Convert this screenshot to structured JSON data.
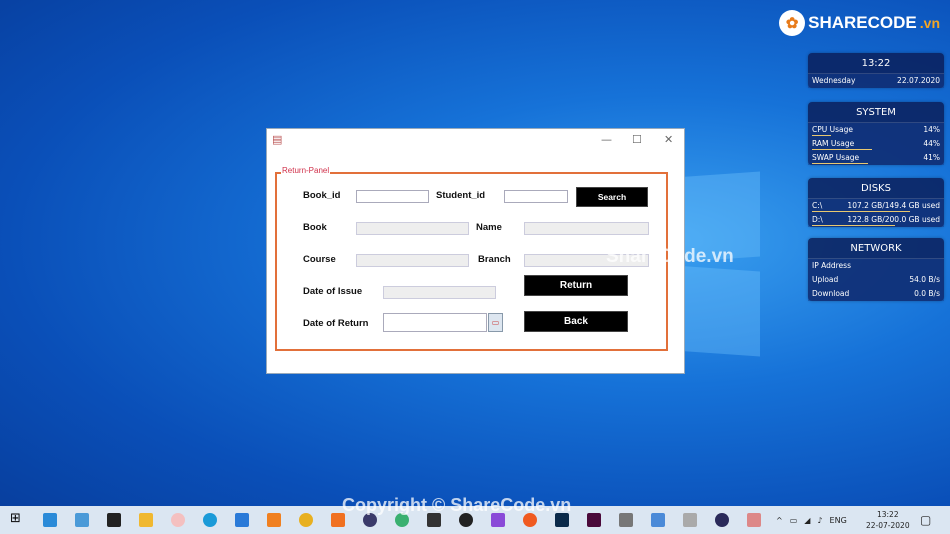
{
  "logo": {
    "text": "SHARECODE",
    "suffix": ".vn"
  },
  "widgets": {
    "clock": {
      "time": "13:22",
      "day": "Wednesday",
      "date": "22.07.2020"
    },
    "system": {
      "title": "SYSTEM",
      "rows": [
        {
          "label": "CPU Usage",
          "value": "14%",
          "pct": 14
        },
        {
          "label": "RAM Usage",
          "value": "44%",
          "pct": 44
        },
        {
          "label": "SWAP Usage",
          "value": "41%",
          "pct": 41
        }
      ]
    },
    "disks": {
      "title": "DISKS",
      "rows": [
        {
          "label": "C:\\",
          "value": "107.2 GB/149.4 GB used",
          "pct": 72
        },
        {
          "label": "D:\\",
          "value": "122.8 GB/200.0 GB used",
          "pct": 61
        }
      ]
    },
    "network": {
      "title": "NETWORK",
      "rows": [
        {
          "label": "IP Address",
          "value": ""
        },
        {
          "label": "Upload",
          "value": "54.0 B/s"
        },
        {
          "label": "Download",
          "value": "0.0 B/s"
        }
      ]
    }
  },
  "window": {
    "panel_title": "Return-Panel",
    "labels": {
      "book_id": "Book_id",
      "student_id": "Student_id",
      "book": "Book",
      "name": "Name",
      "course": "Course",
      "branch": "Branch",
      "date_issue": "Date of Issue",
      "date_return": "Date of Return"
    },
    "values": {
      "book_id": "",
      "student_id": "",
      "book": "",
      "name": "",
      "course": "",
      "branch": "",
      "date_issue": "",
      "date_return": ""
    },
    "buttons": {
      "search": "Search",
      "return": "Return",
      "back": "Back"
    }
  },
  "watermarks": {
    "center": "ShareCode.vn",
    "bottom": "Copyright © ShareCode.vn"
  },
  "taskbar": {
    "lang": "ENG",
    "time": "13:22",
    "date": "22-07-2020"
  },
  "colors": {
    "panel_border": "#e2703a",
    "panel_title": "#d0304a"
  }
}
